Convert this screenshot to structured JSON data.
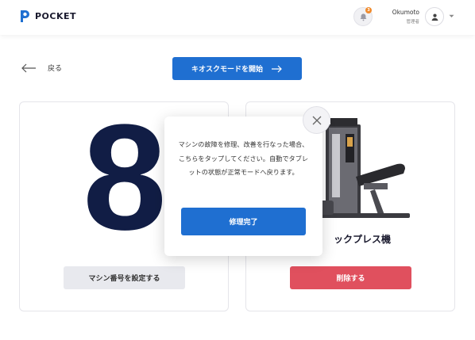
{
  "header": {
    "brand": "POCKET",
    "notification_count": "3",
    "user_name": "Okumoto",
    "user_role": "管理者",
    "brand_color": "#1f6fd1"
  },
  "nav": {
    "back_label": "戻る",
    "kiosk_button_label": "キオスクモードを開始"
  },
  "left_card": {
    "machine_number": "8",
    "set_number_button": "マシン番号を設定する"
  },
  "right_card": {
    "machine_name": "ックプレス機",
    "delete_button": "削除する",
    "delete_color": "#e0505e"
  },
  "modal": {
    "message": "マシンの故障を修理、改善を行なった場合、こちらをタップしてください。自動でタブレットの状態が正常モードへ戻ります。",
    "confirm_button": "修理完了"
  },
  "icons": {
    "bell": "bell-icon",
    "avatar": "user-icon",
    "caret": "chevron-down-icon",
    "back": "arrow-left-icon",
    "kiosk": "arrow-right-icon",
    "close": "close-icon"
  }
}
